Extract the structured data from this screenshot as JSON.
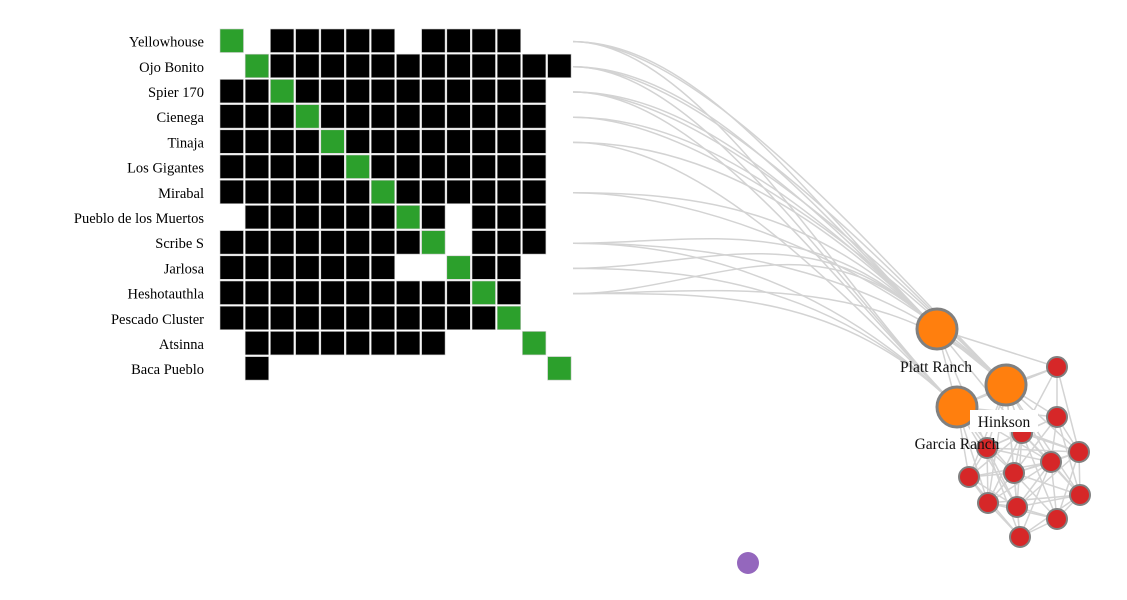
{
  "matrix": {
    "rows": [
      "Yellowhouse",
      "Ojo Bonito",
      "Spier 170",
      "Cienega",
      "Tinaja",
      "Los Gigantes",
      "Mirabal",
      "Pueblo de los Muertos",
      "Scribe S",
      "Jarlosa",
      "Heshotauthla",
      "Pescado Cluster",
      "Atsinna",
      "Baca Pueblo"
    ],
    "cells": [
      "G.BBBBB.BBBB..",
      ".GBBBBBBBBBBBB",
      "BBGBBBBBBBBBB.",
      "BBBGBBBBBBBBB.",
      "BBBBGBBBBBBBB.",
      "BBBBBGBBBBBBB.",
      "BBBBBBGBBBBBB.",
      ".BBBBBBGB.BBB.",
      "BBBBBBBBG.BBB.",
      "BBBBBBB..GBB..",
      "BBBBBBBBBBGB..",
      "BBBBBBBBBBBG..",
      ".BBBBBBBB...G.",
      ".B...........G"
    ],
    "colors": {
      "link": "#000000",
      "self": "#2ca02c",
      "grid": "#ffffff"
    }
  },
  "graph": {
    "nodes": [
      {
        "name": "Platt Ranch",
        "group": "orange",
        "label": "Platt Ranch"
      },
      {
        "name": "Hinkson",
        "group": "orange",
        "label": "Hinkson"
      },
      {
        "name": "Garcia Ranch",
        "group": "orange",
        "label": "Garcia Ranch"
      },
      {
        "group": "red"
      },
      {
        "group": "red"
      },
      {
        "group": "red"
      },
      {
        "group": "red"
      },
      {
        "group": "red"
      },
      {
        "group": "red"
      },
      {
        "group": "red"
      },
      {
        "group": "red"
      },
      {
        "group": "red"
      },
      {
        "group": "red"
      },
      {
        "group": "red"
      },
      {
        "group": "red"
      },
      {
        "group": "red"
      },
      {
        "group": "purple"
      }
    ],
    "matrix_links": [
      {
        "row": "Yellowhouse",
        "targets": [
          "Platt Ranch",
          "Hinkson",
          "Garcia Ranch"
        ]
      },
      {
        "row": "Ojo Bonito",
        "targets": [
          "Platt Ranch",
          "Hinkson",
          "Garcia Ranch"
        ]
      },
      {
        "row": "Spier 170",
        "targets": [
          "Platt Ranch",
          "Hinkson",
          "Garcia Ranch"
        ]
      },
      {
        "row": "Cienega",
        "targets": [
          "Platt Ranch",
          "Hinkson"
        ]
      },
      {
        "row": "Tinaja",
        "targets": [
          "Platt Ranch",
          "Garcia Ranch"
        ]
      },
      {
        "row": "Mirabal",
        "targets": [
          "Platt Ranch",
          "Hinkson"
        ]
      },
      {
        "row": "Scribe S",
        "targets": [
          "Platt Ranch",
          "Hinkson",
          "Garcia Ranch"
        ]
      },
      {
        "row": "Jarlosa",
        "targets": [
          "Platt Ranch",
          "Garcia Ranch"
        ]
      },
      {
        "row": "Heshotauthla",
        "targets": [
          "Platt Ranch",
          "Hinkson",
          "Garcia Ranch"
        ]
      }
    ],
    "colors": {
      "orange": "#ff7f0e",
      "red": "#d62728",
      "purple": "#9467bd",
      "stroke": "#808080",
      "edge": "#d3d3d3"
    }
  }
}
